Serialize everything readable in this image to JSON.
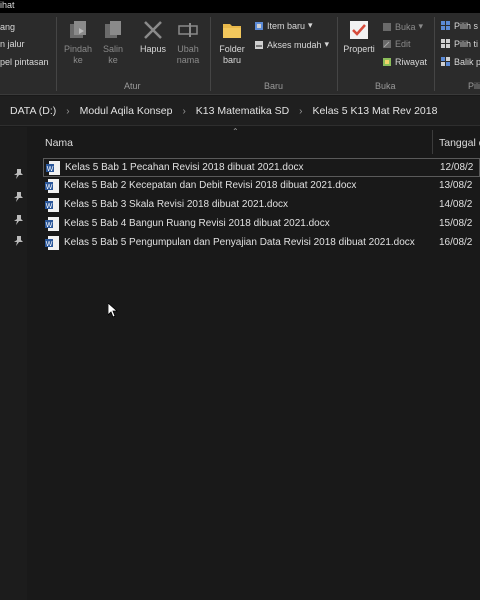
{
  "tabstrip": {
    "label": "ihat"
  },
  "ribbon": {
    "clipboard_partial": {
      "row1": "ang",
      "row2": "n jalur",
      "row3": "pel pintasan"
    },
    "atur": {
      "group_label": "Atur",
      "pindahkan": "Pindah\nke",
      "salin": "Salin\nke",
      "hapus": "Hapus",
      "ubah_nama": "Ubah\nnama"
    },
    "baru": {
      "group_label": "Baru",
      "folder_baru": "Folder\nbaru",
      "item_baru": "Item baru",
      "akses_mudah": "Akses mudah"
    },
    "buka": {
      "group_label": "Buka",
      "properti": "Properti",
      "buka": "Buka",
      "edit": "Edit",
      "riwayat": "Riwayat"
    },
    "pilih": {
      "group_label": "Pili",
      "pilih_semua": "Pilih s",
      "pilih_tidak": "Pilih ti",
      "balik": "Balik p"
    }
  },
  "address": {
    "crumbs": [
      "DATA (D:)",
      "Modul Aqila Konsep",
      "K13 Matematika SD",
      "Kelas 5 K13 Mat Rev 2018"
    ]
  },
  "columns": {
    "name": "Nama",
    "date": "Tanggal d"
  },
  "files": [
    {
      "name": "Kelas 5 Bab 1 Pecahan Revisi 2018 dibuat 2021.docx",
      "date": "12/08/2"
    },
    {
      "name": "Kelas 5 Bab 2 Kecepatan dan Debit Revisi 2018 dibuat 2021.docx",
      "date": "13/08/2"
    },
    {
      "name": "Kelas 5 Bab 3 Skala Revisi 2018 dibuat 2021.docx",
      "date": "14/08/2"
    },
    {
      "name": "Kelas 5 Bab 4 Bangun Ruang Revisi 2018 dibuat 2021.docx",
      "date": "15/08/2"
    },
    {
      "name": "Kelas 5 Bab 5 Pengumpulan dan Penyajian Data Revisi 2018 dibuat 2021.docx",
      "date": "16/08/2"
    }
  ],
  "icons": {
    "word_doc": "word-document-icon",
    "pin": "pin-icon",
    "cursor": "mouse-cursor-icon"
  },
  "colors": {
    "background": "#191919",
    "ribbon": "#2b2b2b",
    "word_blue": "#2b579a",
    "folder_yellow": "#e8b84a",
    "properti_red": "#d64b3b"
  }
}
